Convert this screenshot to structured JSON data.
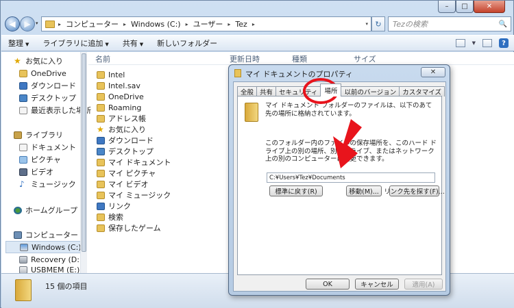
{
  "window": {
    "minimize": "–",
    "maximize": "□",
    "close": "✕"
  },
  "nav": {
    "back": "◀",
    "forward": "▶",
    "history_dropdown": "▾",
    "breadcrumb": [
      "コンピューター",
      "Windows (C:)",
      "ユーザー",
      "Tez"
    ],
    "separator": "▸",
    "address_dropdown": "▾",
    "refresh": "↻",
    "search_placeholder": "Tezの検索",
    "search_icon": "🔍"
  },
  "toolbar": {
    "organize": "整理",
    "add_to_library": "ライブラリに追加",
    "share": "共有",
    "new_folder": "新しいフォルダー",
    "dropdown": "▼",
    "view_dropdown": "▼",
    "help": "?"
  },
  "sidebar": {
    "items": [
      {
        "label": "お気に入り",
        "icon": "star-icon"
      },
      {
        "label": "OneDrive",
        "icon": "onedrive-icon"
      },
      {
        "label": "ダウンロード",
        "icon": "download-icon"
      },
      {
        "label": "デスクトップ",
        "icon": "desktop-icon"
      },
      {
        "label": "最近表示した場所",
        "icon": "recent-places-icon"
      },
      {
        "label": "ライブラリ",
        "icon": "library-icon"
      },
      {
        "label": "ドキュメント",
        "icon": "documents-icon"
      },
      {
        "label": "ピクチャ",
        "icon": "pictures-icon"
      },
      {
        "label": "ビデオ",
        "icon": "videos-icon"
      },
      {
        "label": "ミュージック",
        "icon": "music-icon"
      },
      {
        "label": "ホームグループ",
        "icon": "homegroup-icon"
      },
      {
        "label": "コンピューター",
        "icon": "computer-icon"
      },
      {
        "label": "Windows (C:)",
        "icon": "windows-drive-icon"
      },
      {
        "label": "Recovery (D:)",
        "icon": "drive-icon"
      },
      {
        "label": "USBMEM (E:)",
        "icon": "usb-drive-icon"
      }
    ]
  },
  "columns": {
    "name": "名前",
    "modified": "更新日時",
    "type": "種類",
    "size": "サイズ"
  },
  "files": [
    "Intel",
    "Intel.sav",
    "OneDrive",
    "Roaming",
    "アドレス帳",
    "お気に入り",
    "ダウンロード",
    "デスクトップ",
    "マイ ドキュメント",
    "マイ ピクチャ",
    "マイ ビデオ",
    "マイ ミュージック",
    "リンク",
    "検索",
    "保存したゲーム"
  ],
  "status": {
    "count": "15 個の項目"
  },
  "dialog": {
    "title": "マイ ドキュメントのプロパティ",
    "close": "✕",
    "tabs": [
      "全般",
      "共有",
      "セキュリティ",
      "場所",
      "以前のバージョン",
      "カスタマイズ"
    ],
    "active_tab": "場所",
    "description1": "マイ ドキュメント フォルダーのファイルは、以下のあて先の場所に格納されています。",
    "description2": "このフォルダー内のファイルの保存場所を、このハード ドライブ上の別の場所、別のドライブ、またはネットワーク上の別のコンピューターに変更できます。",
    "path": "C:¥Users¥Tez¥Documents",
    "btn_restore": "標準に戻す(R)",
    "btn_move": "移動(M)...",
    "btn_find": "リンク先を探す(F)...",
    "btn_ok": "OK",
    "btn_cancel": "キャンセル",
    "btn_apply": "適用(A)"
  },
  "colors": {
    "annotation_red": "#e8141c",
    "window_frame": "#bcd3ea"
  }
}
